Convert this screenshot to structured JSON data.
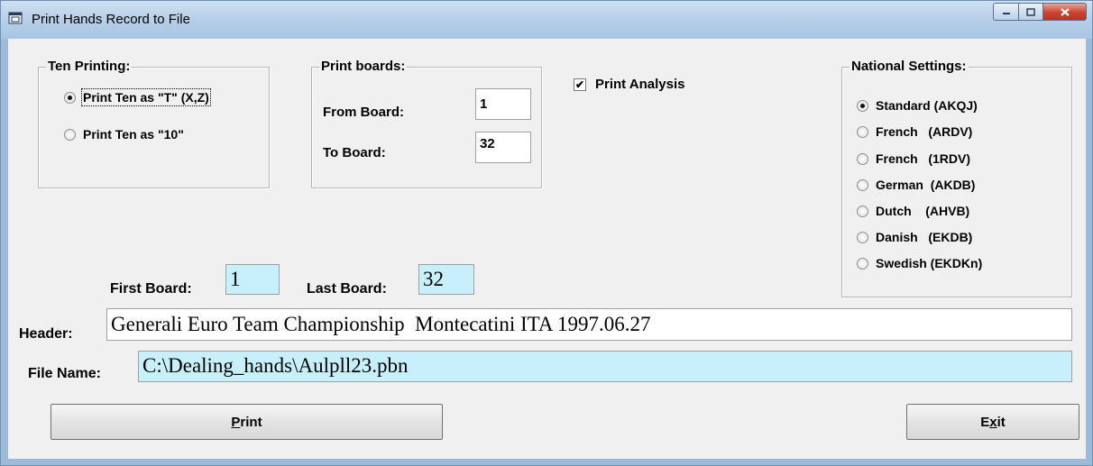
{
  "window": {
    "title": "Print Hands Record to File"
  },
  "ten_printing": {
    "legend": "Ten Printing:",
    "options": [
      {
        "label": "Print Ten as \"T\" (X,Z)",
        "selected": true
      },
      {
        "label": "Print Ten as \"10\"",
        "selected": false
      }
    ]
  },
  "print_boards": {
    "legend": "Print boards:",
    "from_label": "From Board:",
    "from_value": "1",
    "to_label": "To Board:",
    "to_value": "32"
  },
  "print_analysis": {
    "label": "Print Analysis",
    "checked": true
  },
  "national_settings": {
    "legend": "National Settings:",
    "options": [
      {
        "label": "Standard (AKQJ)",
        "selected": true
      },
      {
        "label": "French   (ARDV)",
        "selected": false
      },
      {
        "label": "French   (1RDV)",
        "selected": false
      },
      {
        "label": "German  (AKDB)",
        "selected": false
      },
      {
        "label": "Dutch    (AHVB)",
        "selected": false
      },
      {
        "label": "Danish   (EKDB)",
        "selected": false
      },
      {
        "label": "Swedish (EKDKn)",
        "selected": false
      }
    ]
  },
  "first_board": {
    "label": "First Board:",
    "value": "1"
  },
  "last_board": {
    "label": "Last Board:",
    "value": "32"
  },
  "header": {
    "label": "Header:",
    "value": "Generali Euro Team Championship  Montecatini ITA 1997.06.27"
  },
  "file_name": {
    "label": "File Name:",
    "value": "C:\\Dealing_hands\\Aulpll23.pbn"
  },
  "buttons": {
    "print_pre": "",
    "print_ul": "P",
    "print_post": "rint",
    "exit_pre": "E",
    "exit_ul": "x",
    "exit_post": "it"
  }
}
